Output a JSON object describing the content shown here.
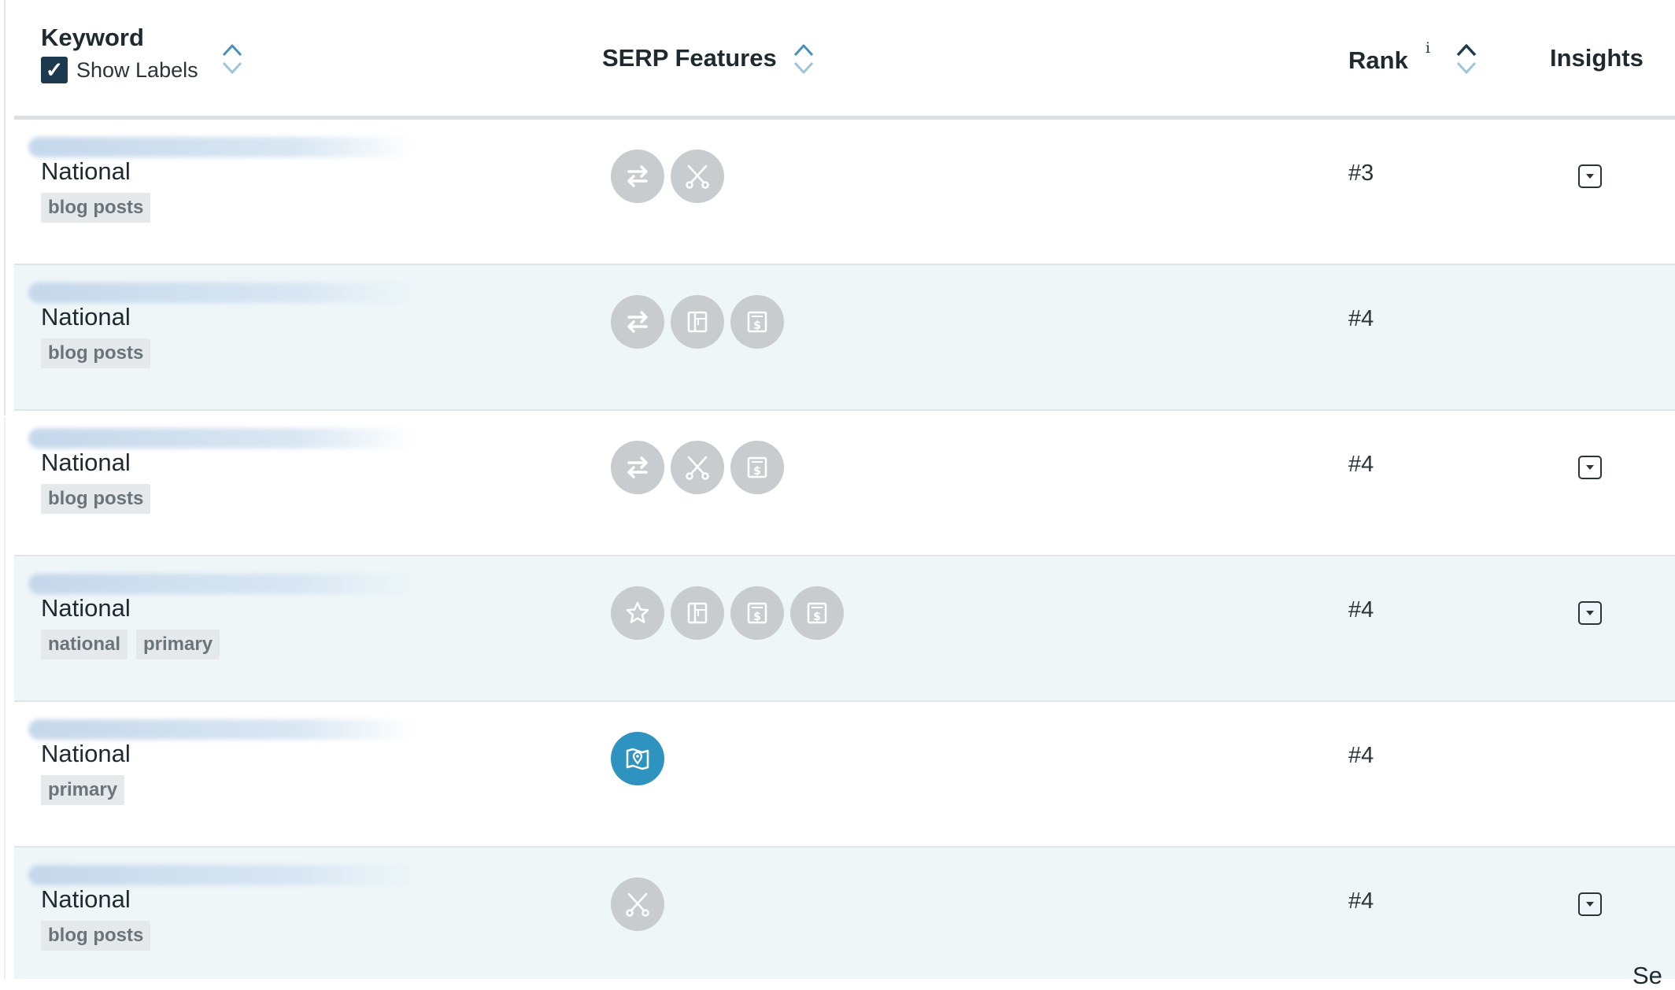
{
  "header": {
    "keyword": "Keyword",
    "show_labels": "Show Labels",
    "serp_features": "SERP Features",
    "rank": "Rank",
    "rank_info": "i",
    "insights": "Insights"
  },
  "colors": {
    "feature_inactive": "#c8cccf",
    "feature_active": "#2f93bf",
    "row_alt_bg": "#eef6f8",
    "checkbox": "#1d3a4f"
  },
  "rows": [
    {
      "location": "National",
      "labels": [
        "blog posts"
      ],
      "features": [
        "swap-arrows-icon",
        "scissors-icon"
      ],
      "rank": "#3",
      "insights_toggle": true
    },
    {
      "location": "National",
      "labels": [
        "blog posts"
      ],
      "features": [
        "swap-arrows-icon",
        "layout-panel-icon",
        "dollar-ad-icon"
      ],
      "rank": "#4",
      "insights_toggle": false
    },
    {
      "location": "National",
      "labels": [
        "blog posts"
      ],
      "features": [
        "swap-arrows-icon",
        "scissors-icon",
        "dollar-ad-icon"
      ],
      "rank": "#4",
      "insights_toggle": true
    },
    {
      "location": "National",
      "labels": [
        "national",
        "primary"
      ],
      "features": [
        "star-icon",
        "layout-panel-icon",
        "dollar-ad-icon",
        "dollar-ad-icon"
      ],
      "rank": "#4",
      "insights_toggle": true
    },
    {
      "location": "National",
      "labels": [
        "primary"
      ],
      "features": [
        "map-pin-icon"
      ],
      "active_features": [
        "map-pin-icon"
      ],
      "rank": "#4",
      "insights_toggle": false
    },
    {
      "location": "National",
      "labels": [
        "blog posts"
      ],
      "features": [
        "scissors-icon"
      ],
      "rank": "#4",
      "insights_toggle": true
    }
  ],
  "corner_text": "Se"
}
